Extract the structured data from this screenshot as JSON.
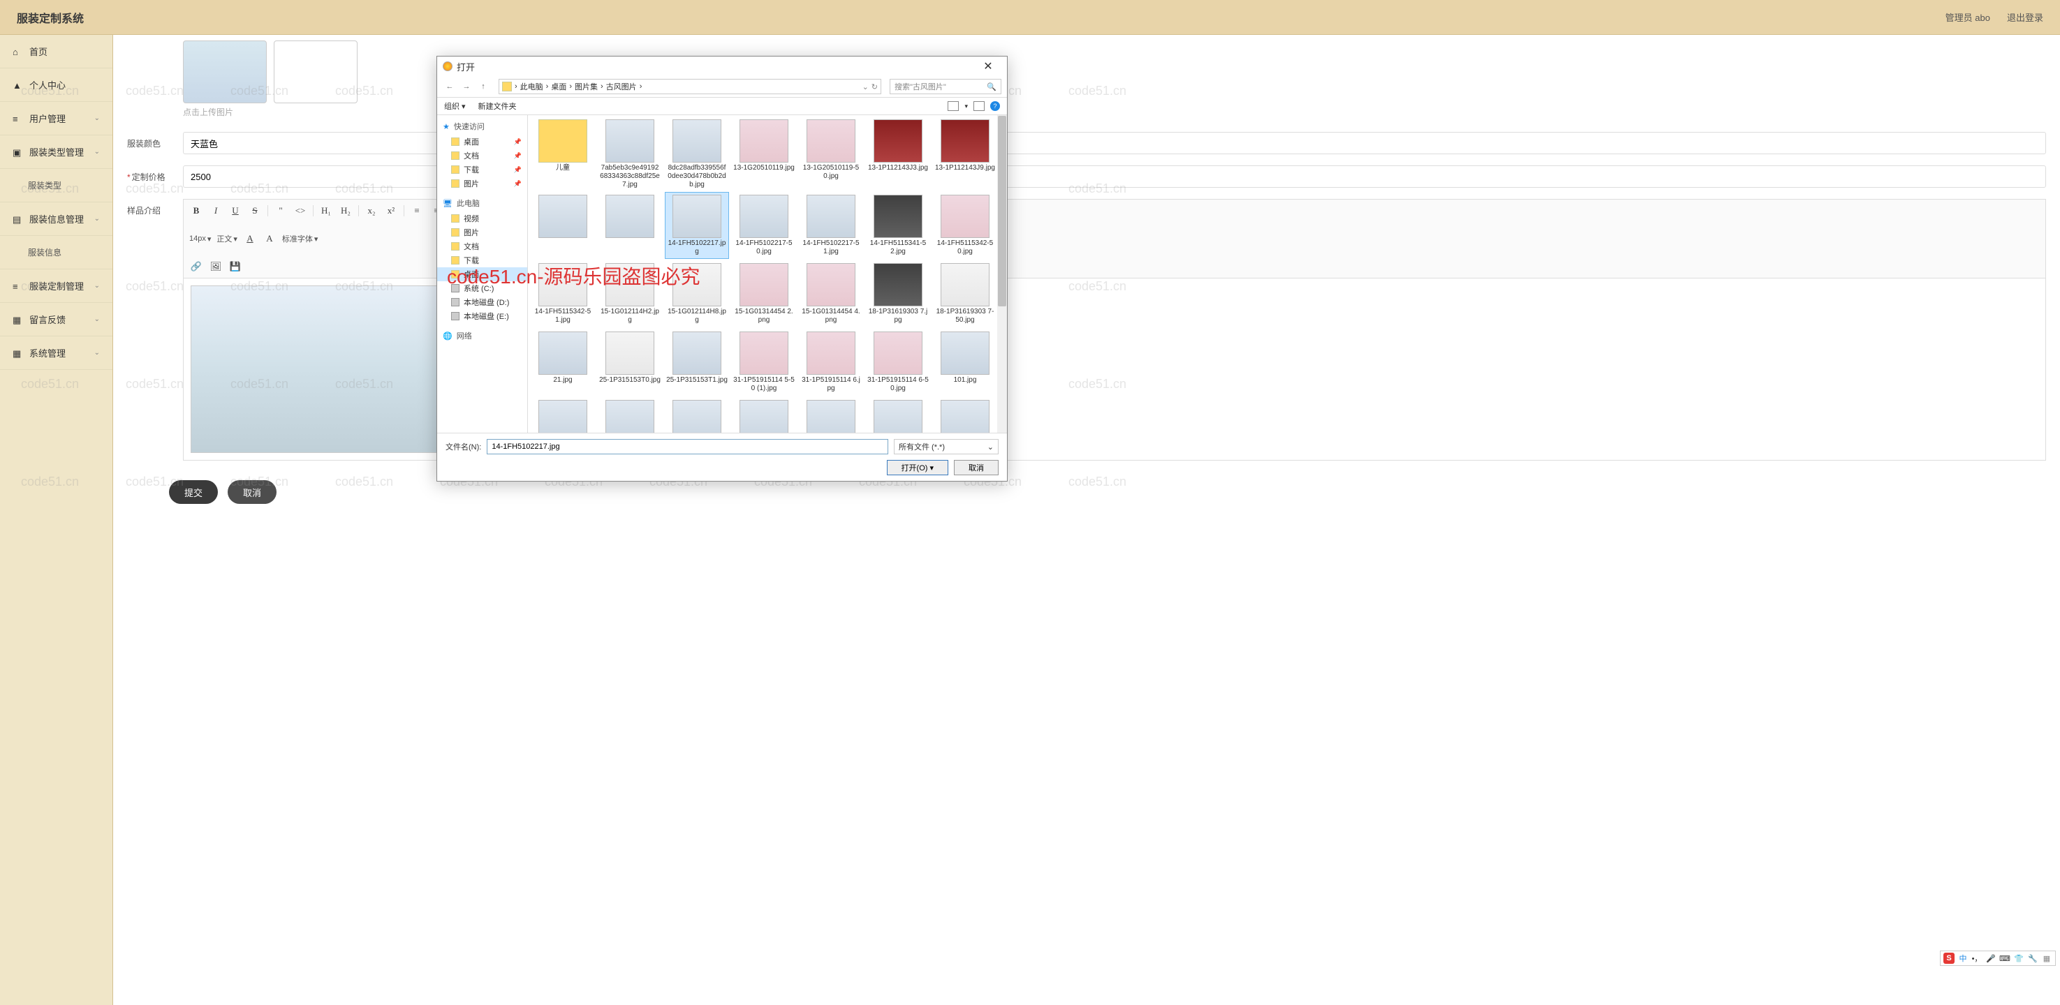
{
  "header": {
    "title": "服装定制系统",
    "user": "管理员 abo",
    "logout": "退出登录"
  },
  "sidebar": {
    "home": "首页",
    "profile": "个人中心",
    "user_mgmt": "用户管理",
    "type_mgmt": "服装类型管理",
    "type_sub": "服装类型",
    "info_mgmt": "服装信息管理",
    "info_sub": "服装信息",
    "custom_mgmt": "服装定制管理",
    "feedback": "留言反馈",
    "system": "系统管理"
  },
  "form": {
    "upload_hint": "点击上传图片",
    "color_label": "服装颜色",
    "color_value": "天蓝色",
    "price_label": "定制价格",
    "price_value": "2500",
    "desc_label": "样品介绍",
    "submit": "提交",
    "cancel": "取消"
  },
  "editor": {
    "font_size": "14px",
    "font_family": "正文",
    "font_style": "标准字体"
  },
  "file_dialog": {
    "title": "打开",
    "breadcrumb": [
      "此电脑",
      "桌面",
      "图片集",
      "古风图片"
    ],
    "search_placeholder": "搜索\"古风图片\"",
    "organize": "组织",
    "new_folder": "新建文件夹",
    "tree": {
      "quick": "快速访问",
      "desktop": "桌面",
      "docs": "文档",
      "downloads": "下载",
      "pictures": "图片",
      "this_pc": "此电脑",
      "videos": "视频",
      "pictures2": "图片",
      "docs2": "文档",
      "downloads2": "下载",
      "desktop2": "桌面",
      "drive_c": "系统 (C:)",
      "drive_d": "本地磁盘 (D:)",
      "drive_e": "本地磁盘 (E:)",
      "network": "网络"
    },
    "files": [
      {
        "name": "儿童",
        "type": "folder",
        "cls": "folder"
      },
      {
        "name": "7ab5eb3c9e4919268334363c88df25e7.jpg",
        "cls": ""
      },
      {
        "name": "8dc28adfb339556f0dee30d478b0b2db.jpg",
        "cls": ""
      },
      {
        "name": "13-1G20510119.jpg",
        "cls": "pink"
      },
      {
        "name": "13-1G20510119-50.jpg",
        "cls": "pink"
      },
      {
        "name": "13-1P112143J3.jpg",
        "cls": "red"
      },
      {
        "name": "13-1P112143J9.jpg",
        "cls": "red"
      },
      {
        "name": "",
        "cls": ""
      },
      {
        "name": "",
        "cls": ""
      },
      {
        "name": "14-1FH5102217.jpg",
        "cls": "",
        "sel": true
      },
      {
        "name": "14-1FH5102217-50.jpg",
        "cls": ""
      },
      {
        "name": "14-1FH5102217-51.jpg",
        "cls": ""
      },
      {
        "name": "14-1FH5115341-52.jpg",
        "cls": "dark"
      },
      {
        "name": "14-1FH5115342-50.jpg",
        "cls": "pink"
      },
      {
        "name": "14-1FH5115342-51.jpg",
        "cls": "white"
      },
      {
        "name": "15-1G012114H2.jpg",
        "cls": "white"
      },
      {
        "name": "15-1G012114H8.jpg",
        "cls": "white"
      },
      {
        "name": "15-1G01314454 2.png",
        "cls": "pink"
      },
      {
        "name": "15-1G01314454 4.png",
        "cls": "pink"
      },
      {
        "name": "18-1P31619303 7.jpg",
        "cls": "dark"
      },
      {
        "name": "18-1P31619303 7-50.jpg",
        "cls": "white"
      },
      {
        "name": "21.jpg",
        "cls": ""
      },
      {
        "name": "25-1P315153T0.jpg",
        "cls": "white"
      },
      {
        "name": "25-1P315153T1.jpg",
        "cls": ""
      },
      {
        "name": "31-1P51915114 5-50 (1).jpg",
        "cls": "pink"
      },
      {
        "name": "31-1P51915114 6.jpg",
        "cls": "pink"
      },
      {
        "name": "31-1P51915114 6-50.jpg",
        "cls": "pink"
      },
      {
        "name": "101.jpg",
        "cls": ""
      },
      {
        "name": "",
        "cls": ""
      },
      {
        "name": "",
        "cls": ""
      },
      {
        "name": "",
        "cls": ""
      },
      {
        "name": "",
        "cls": ""
      },
      {
        "name": "",
        "cls": ""
      },
      {
        "name": "",
        "cls": ""
      },
      {
        "name": "",
        "cls": ""
      }
    ],
    "filename_label": "文件名(N):",
    "filename_value": "14-1FH5102217.jpg",
    "filetype": "所有文件 (*.*)",
    "open_btn": "打开(O)",
    "cancel_btn": "取消"
  },
  "watermark": "code51.cn",
  "watermark_red": "code51.cn-源码乐园盗图必究",
  "ime": {
    "s": "S",
    "cn": "中"
  }
}
